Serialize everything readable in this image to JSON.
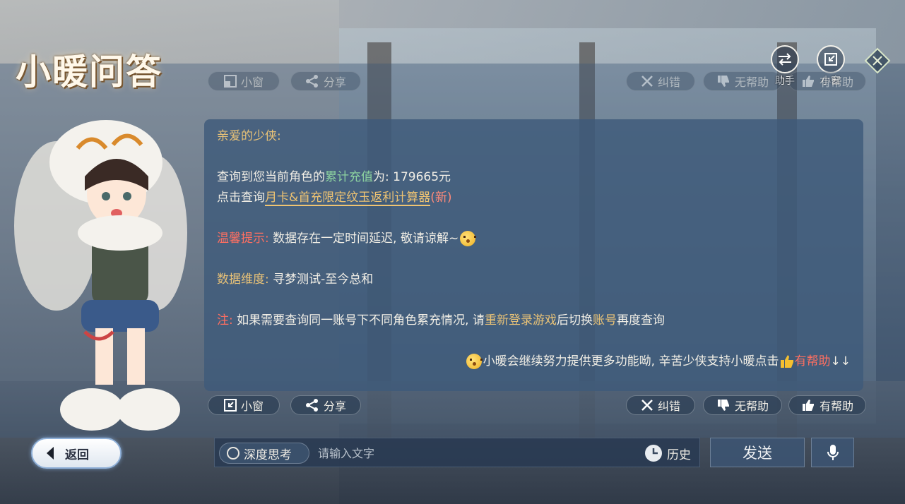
{
  "app": {
    "title": "小暖问答"
  },
  "top_right": {
    "assistant_label": "助手",
    "mini_window_label": "小窗"
  },
  "toolbar_top": {
    "mini_window": "小窗",
    "share": "分享",
    "correct": "纠错",
    "not_helpful": "无帮助",
    "helpful": "有帮助"
  },
  "message": {
    "greeting": "亲爱的少侠:",
    "query_prefix": "查询到您当前角色的",
    "query_highlight": "累计充值",
    "query_suffix": "为: 179665元",
    "calc_prefix": "点击查询",
    "calc_link": "月卡&首充限定纹玉返利计算器",
    "calc_new": "(新)",
    "tip_label": "温馨提示:",
    "tip_text": "数据存在一定时间延迟, 敬请谅解~",
    "dimension_label": "数据维度:",
    "dimension_text": "寻梦测试-至今总和",
    "note_label": "注:",
    "note_text_1": "如果需要查询同一账号下不同角色累充情况, 请",
    "note_relogin": "重新登录游戏",
    "note_text_2": "后切换",
    "note_account": "账号",
    "note_text_3": "再度查询",
    "footer_text": "小暖会继续努力提供更多功能呦, 辛苦少侠支持小暖点击",
    "footer_helpful": "有帮助",
    "footer_arrows": "↓↓"
  },
  "toolbar_bottom": {
    "mini_window": "小窗",
    "share": "分享",
    "correct": "纠错",
    "not_helpful": "无帮助",
    "helpful": "有帮助"
  },
  "bottom": {
    "back": "返回",
    "deep_think": "深度思考",
    "input_placeholder": "请输入文字",
    "history": "历史",
    "send": "发送"
  },
  "icons": [
    "swap-icon",
    "mini-window-icon",
    "close-diamond-icon",
    "share-icon",
    "x-icon",
    "thumbs-down-icon",
    "thumbs-up-icon",
    "back-arrow-icon",
    "clock-icon",
    "mic-icon"
  ]
}
